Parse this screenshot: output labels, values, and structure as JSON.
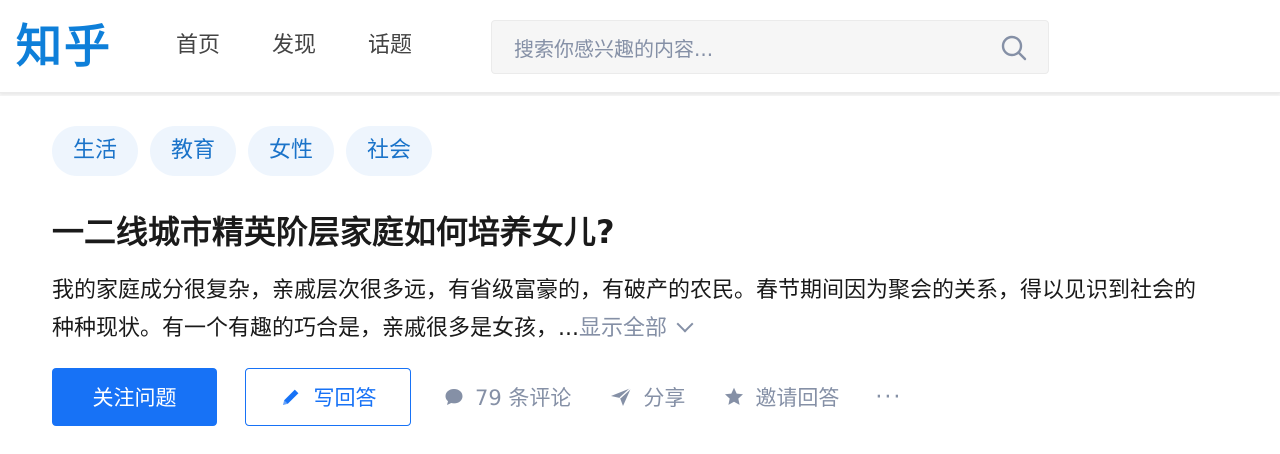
{
  "header": {
    "logo_text": "知乎",
    "nav": [
      {
        "label": "首页"
      },
      {
        "label": "发现"
      },
      {
        "label": "话题"
      }
    ],
    "search": {
      "placeholder": "搜索你感兴趣的内容..."
    }
  },
  "question": {
    "topics": [
      {
        "label": "生活"
      },
      {
        "label": "教育"
      },
      {
        "label": "女性"
      },
      {
        "label": "社会"
      }
    ],
    "title": "一二线城市精英阶层家庭如何培养女儿?",
    "excerpt": "我的家庭成分很复杂，亲戚层次很多远，有省级富豪的，有破产的农民。春节期间因为聚会的关系，得以见识到社会的种种现状。有一个有趣的巧合是，亲戚很多是女孩，...",
    "show_all_label": "显示全部"
  },
  "actions": {
    "follow_label": "关注问题",
    "write_answer_label": "写回答",
    "comments_label": "79 条评论",
    "share_label": "分享",
    "invite_label": "邀请回答",
    "more_label": "···"
  },
  "colors": {
    "brand": "#0e7fd9",
    "primary": "#1772f6",
    "tag_bg": "#eef5fd",
    "tag_text": "#1a73c9",
    "muted": "#8590a6"
  },
  "icons": {
    "search": "search-icon",
    "pencil": "pencil-icon",
    "comment": "comment-bubble-icon",
    "share": "paper-plane-icon",
    "invite": "star-icon",
    "chevron": "chevron-down-icon"
  }
}
